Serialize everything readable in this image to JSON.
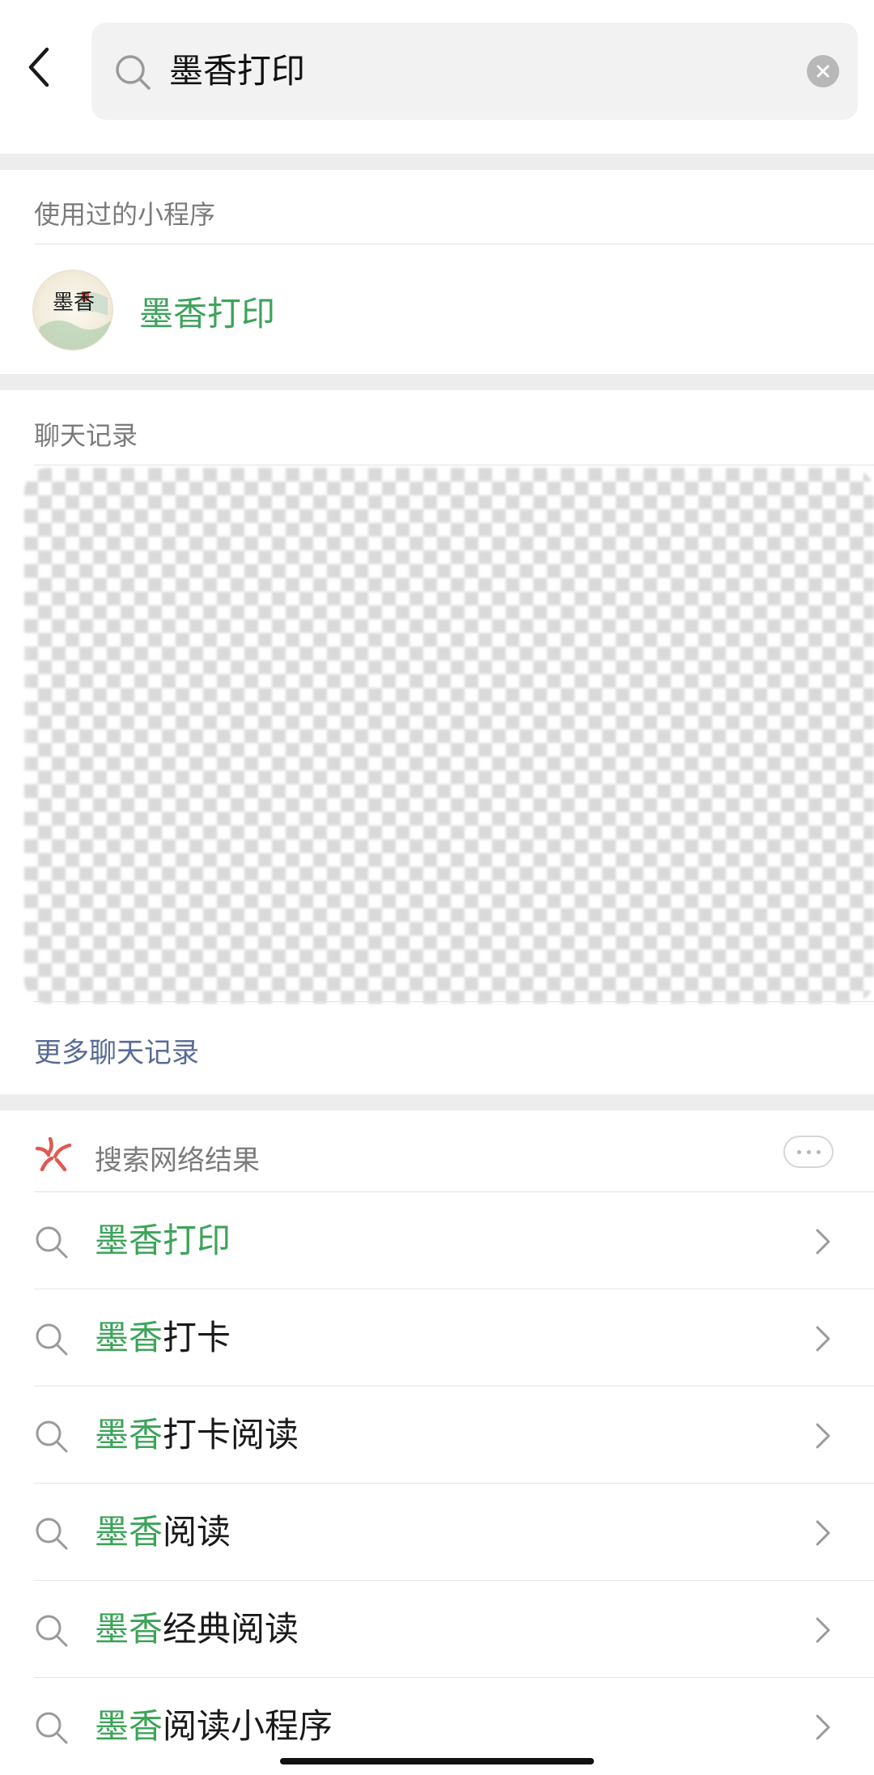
{
  "search": {
    "query": "墨香打印"
  },
  "mini_programs": {
    "header": "使用过的小程序",
    "items": [
      {
        "name": "墨香打印",
        "avatar_text": "墨香"
      }
    ]
  },
  "chat_records": {
    "header": "聊天记录",
    "more_label": "更多聊天记录"
  },
  "web_results": {
    "header": "搜索网络结果",
    "items": [
      {
        "highlight": "墨香打印",
        "rest": ""
      },
      {
        "highlight": "墨香",
        "rest": "打卡"
      },
      {
        "highlight": "墨香",
        "rest": "打卡阅读"
      },
      {
        "highlight": "墨香",
        "rest": "阅读"
      },
      {
        "highlight": "墨香",
        "rest": "经典阅读"
      },
      {
        "highlight": "墨香",
        "rest": "阅读小程序"
      }
    ]
  },
  "colors": {
    "accent_green": "#3da35a",
    "link_blue": "#576b95",
    "section_gray": "#7b7b7b"
  }
}
